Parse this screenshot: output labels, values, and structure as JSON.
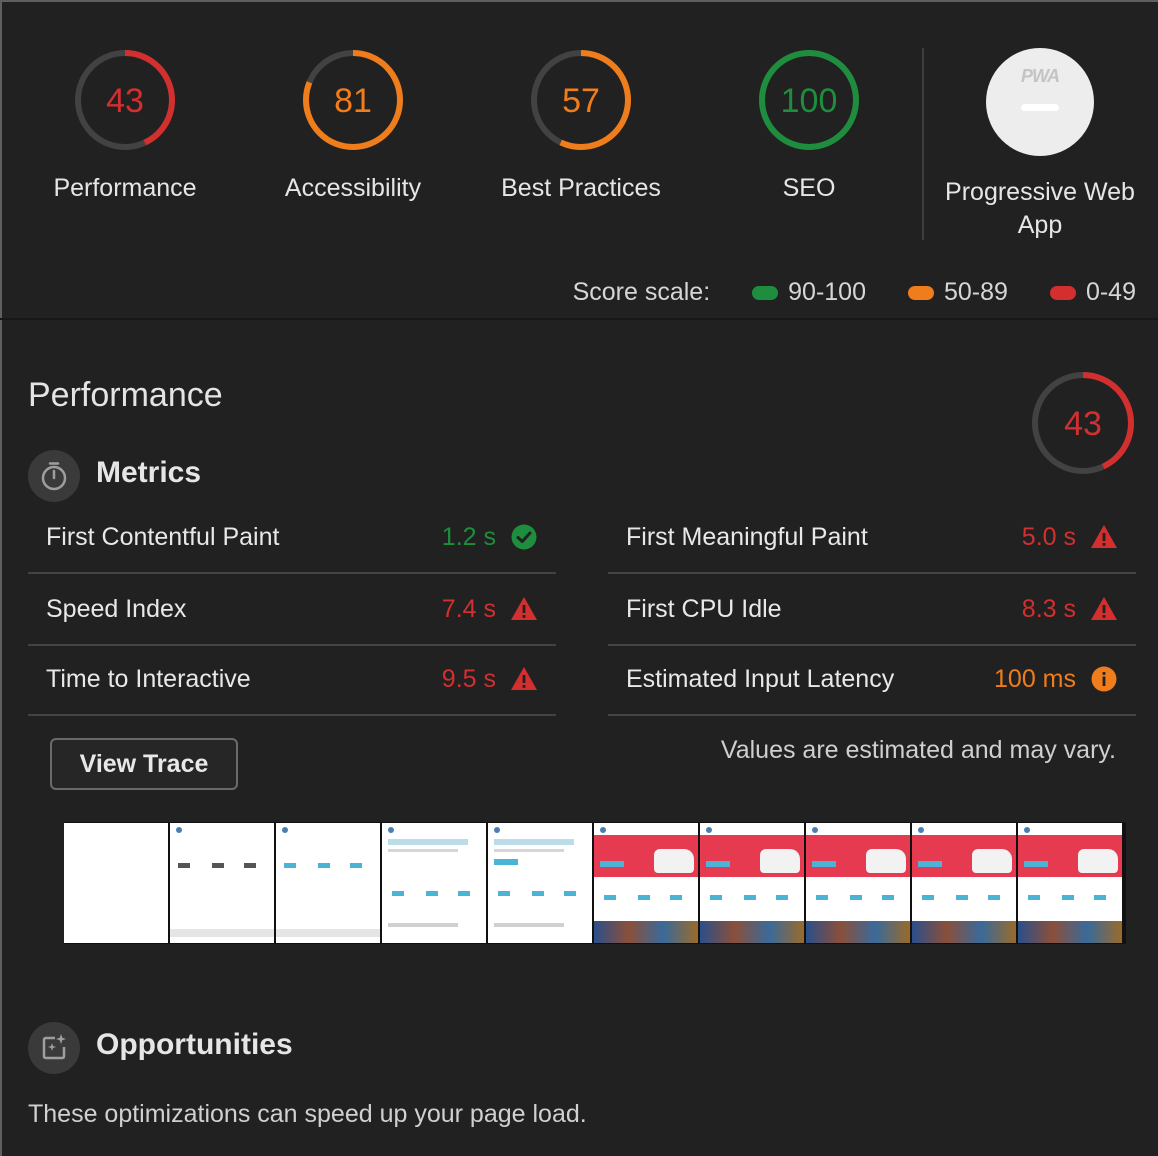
{
  "categories": [
    {
      "id": "performance",
      "score": "43",
      "label": "Performance",
      "value": 0.43,
      "color": "#d32f2f"
    },
    {
      "id": "accessibility",
      "score": "81",
      "label": "Accessibility",
      "value": 0.81,
      "color": "#ef7d1b"
    },
    {
      "id": "best-practices",
      "score": "57",
      "label": "Best Practices",
      "value": 0.57,
      "color": "#ef7d1b"
    },
    {
      "id": "seo",
      "score": "100",
      "label": "SEO",
      "value": 1.0,
      "color": "#1e8e3e"
    }
  ],
  "pwa": {
    "badge": "PWA",
    "label_line1": "Progressive Web",
    "label_line2": "App"
  },
  "scale": {
    "label": "Score scale:",
    "ranges": [
      {
        "text": "90-100",
        "color": "#1e8e3e"
      },
      {
        "text": "50-89",
        "color": "#ef7d1b"
      },
      {
        "text": "0-49",
        "color": "#d32f2f"
      }
    ]
  },
  "performance": {
    "title": "Performance",
    "score": "43",
    "value": 0.43,
    "metrics_title": "Metrics",
    "metrics": [
      {
        "name": "First Contentful Paint",
        "value": "1.2 s",
        "status": "pass"
      },
      {
        "name": "First Meaningful Paint",
        "value": "5.0 s",
        "status": "fail"
      },
      {
        "name": "Speed Index",
        "value": "7.4 s",
        "status": "fail"
      },
      {
        "name": "First CPU Idle",
        "value": "8.3 s",
        "status": "fail"
      },
      {
        "name": "Time to Interactive",
        "value": "9.5 s",
        "status": "fail"
      },
      {
        "name": "Estimated Input Latency",
        "value": "100 ms",
        "status": "average"
      }
    ],
    "view_trace": "View Trace",
    "note": "Values are estimated and may vary.",
    "filmstrip_count": 10
  },
  "opportunities": {
    "title": "Opportunities",
    "description": "These optimizations can speed up your page load."
  },
  "colors": {
    "pass": "#1e8e3e",
    "average": "#ef7d1b",
    "fail": "#d32f2f",
    "track": "#424242"
  }
}
